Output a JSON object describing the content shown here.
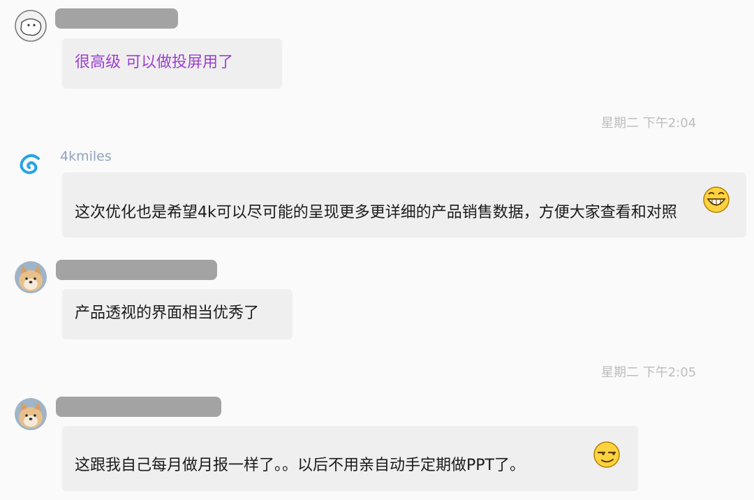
{
  "messages": [
    {
      "avatar_icon": "white-ghost-avatar",
      "sender": "",
      "text": "很高级  可以做投屏用了",
      "text_color": "#9b3fd1"
    },
    {
      "avatar_icon": "4kmiles-logo-avatar",
      "sender": "4kmiles",
      "text": "这次优化也是希望4k可以尽可能的呈现更多更详细的产品销售数据，方便大家查看和对照",
      "emoji_icon": "grinning-face-icon"
    },
    {
      "avatar_icon": "shiba-dog-avatar",
      "sender": "",
      "text": "产品透视的界面相当优秀了"
    },
    {
      "avatar_icon": "shiba-dog-avatar",
      "sender": "",
      "text": "这跟我自己每月做月报一样了。。以后不用亲自动手定期做PPT了。",
      "emoji_icon": "smug-face-icon"
    }
  ],
  "timestamps": [
    "星期二  下午2:04",
    "星期二  下午2:05"
  ],
  "colors": {
    "background": "#fbfafb",
    "bubble": "#f0eff0",
    "redacted_name": "#a3a3a3",
    "sender_name": "#8fa3bd",
    "timestamp": "#bdbdbd",
    "accent_purple": "#9b3fd1",
    "logo_blue": "#29a4e6"
  }
}
